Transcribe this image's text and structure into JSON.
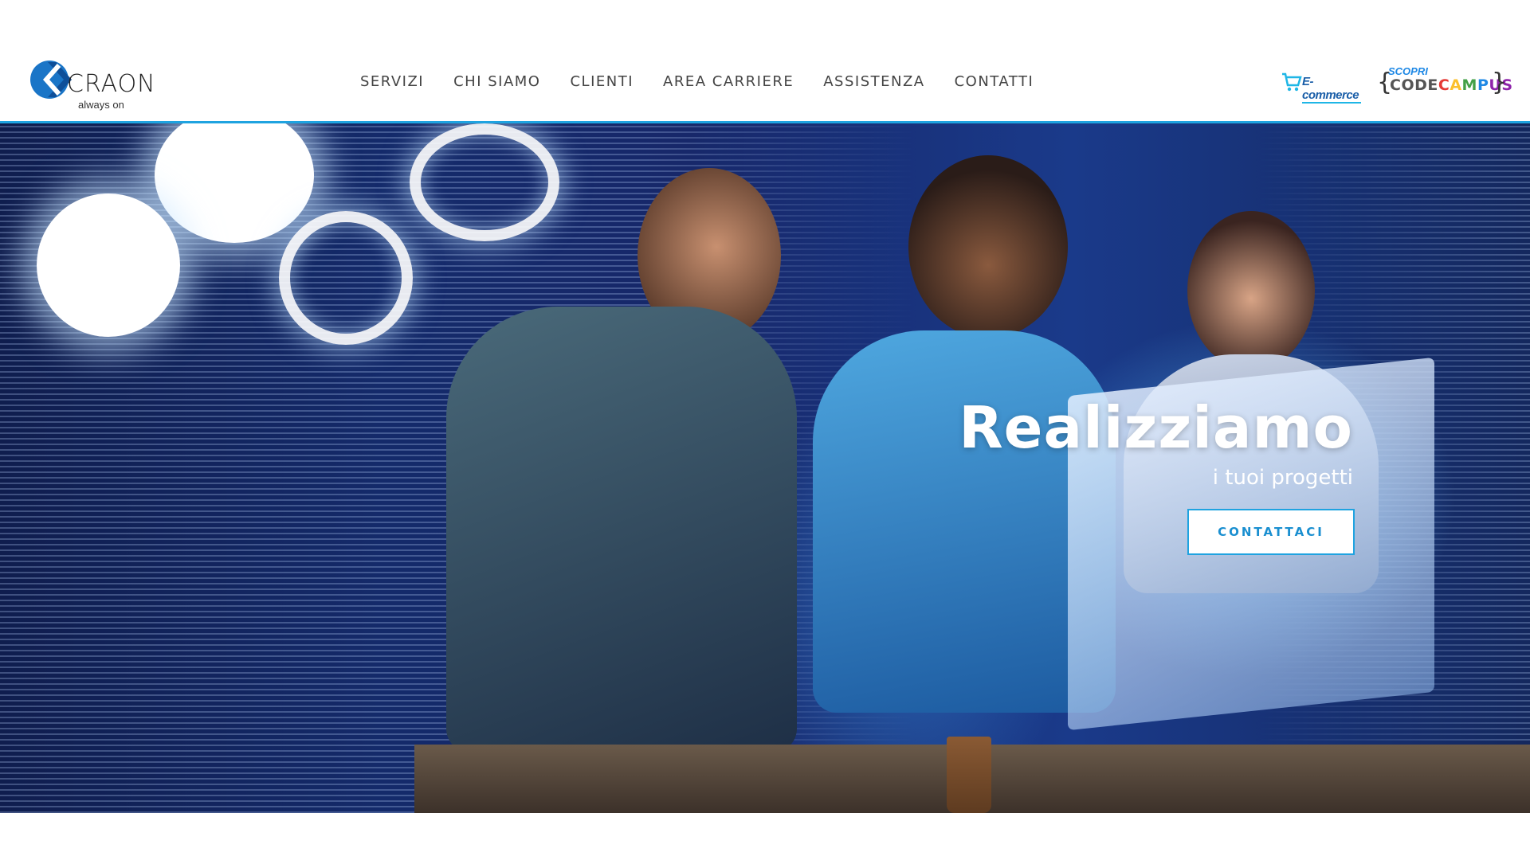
{
  "header": {
    "logo": {
      "word": "CRAON",
      "tagline": "always on"
    },
    "nav": [
      {
        "label": "SERVIZI"
      },
      {
        "label": "CHI SIAMO"
      },
      {
        "label": "CLIENTI"
      },
      {
        "label": "AREA CARRIERE"
      },
      {
        "label": "ASSISTENZA"
      },
      {
        "label": "CONTATTI"
      }
    ],
    "ecommerce": {
      "label": "E-commerce",
      "icon": "cart-icon"
    },
    "codecampus": {
      "top": "SCOPRI",
      "letters": [
        "CODE",
        "C",
        "A",
        "M",
        "P",
        "US"
      ],
      "brace_open": "{",
      "brace_close": "}"
    }
  },
  "hero": {
    "title": "Realizziamo",
    "subtitle": "i tuoi progetti",
    "cta_label": "CONTATTACI"
  },
  "colors": {
    "accent": "#1fa3e0",
    "logo_blue": "#1a75c7",
    "hero_dark": "#142a6a"
  }
}
